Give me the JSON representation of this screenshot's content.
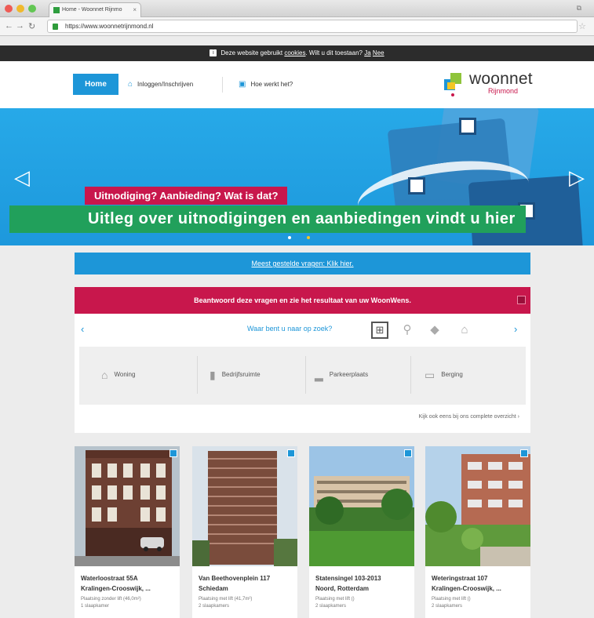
{
  "browser": {
    "tab_title": "Home - Woonnet Rijnmo",
    "url": "https://www.woonnetrijnmond.nl"
  },
  "cookie_bar": {
    "text": "Deze website gebruikt",
    "link": "cookies",
    "question": ". Wilt u dit toestaan?",
    "ja": "Ja",
    "nee": "Nee"
  },
  "header": {
    "home": "Home",
    "nav": [
      "Inloggen/Inschrijven",
      "Hoe werkt het?"
    ],
    "logo_main": "woonnet",
    "logo_sub": "Rijnmond"
  },
  "hero": {
    "tag": "Uitnodiging? Aanbieding? Wat is dat?",
    "title": "Uitleg over uitnodigingen en aanbiedingen vindt u hier"
  },
  "faq": {
    "text": "Meest gestelde vragen: Klik hier."
  },
  "survey": {
    "heading": "Beantwoord deze vragen en zie het resultaat van uw WoonWens.",
    "question": "Waar bent u naar op zoek?",
    "options": [
      "Woning",
      "Bedrijfsruimte",
      "Parkeerplaats",
      "Berging"
    ],
    "link": "Kijk ook eens bij ons complete overzicht"
  },
  "listings": [
    {
      "address": "Waterloostraat 55A",
      "area": "Kralingen-Crooswijk, ...",
      "meta1": "Plaatsing zonder lift (46,0m²)",
      "meta2": "1 slaapkamer"
    },
    {
      "address": "Van Beethovenplein 117",
      "area": "Schiedam",
      "meta1": "Plaatsing met lift (41,7m²)",
      "meta2": "2 slaapkamers"
    },
    {
      "address": "Statensingel 103-2013",
      "area": "Noord, Rotterdam",
      "meta1": "Plaatsing met lift ()",
      "meta2": "2 slaapkamers"
    },
    {
      "address": "Weteringstraat 107",
      "area": "Kralingen-Crooswijk, ...",
      "meta1": "Plaatsing met lift ()",
      "meta2": "2 slaapkamers"
    }
  ]
}
